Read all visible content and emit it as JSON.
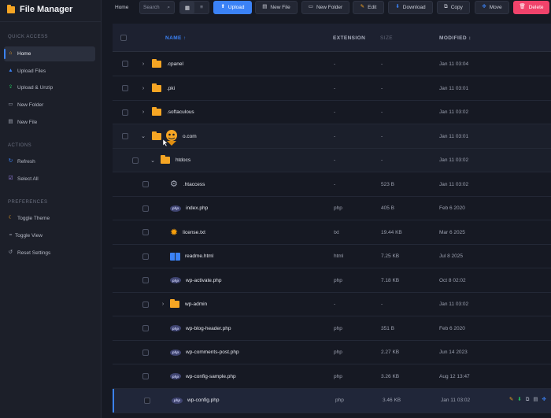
{
  "app": {
    "title": "File Manager"
  },
  "sidebar": {
    "quick_access_label": "QUICK ACCESS",
    "quick_access": [
      {
        "label": "Home",
        "icon": "home-icon",
        "active": true
      },
      {
        "label": "Upload Files",
        "icon": "upload-icon"
      },
      {
        "label": "Upload & Unzip",
        "icon": "upload-unzip-icon"
      },
      {
        "label": "New Folder",
        "icon": "new-folder-icon"
      },
      {
        "label": "New File",
        "icon": "new-file-icon"
      }
    ],
    "actions_label": "ACTIONS",
    "actions": [
      {
        "label": "Refresh",
        "icon": "refresh-icon"
      },
      {
        "label": "Select All",
        "icon": "checkbox-icon"
      }
    ],
    "preferences_label": "PREFERENCES",
    "preferences": [
      {
        "label": "Toggle Theme",
        "icon": "moon-icon"
      },
      {
        "label": "Toggle View",
        "icon": "view-icon"
      },
      {
        "label": "Reset Settings",
        "icon": "reset-icon"
      }
    ]
  },
  "toolbar": {
    "home": "Home",
    "search_placeholder": "Search",
    "upload": "Upload",
    "new_file": "New File",
    "new_folder": "New Folder",
    "edit": "Edit",
    "download": "Download",
    "copy": "Copy",
    "move": "Move",
    "delete": "Delete"
  },
  "colors": {
    "accent": "#3b82f6",
    "danger": "#f0436b",
    "folder": "#f5a524"
  },
  "table": {
    "headers": {
      "name": "NAME",
      "name_sort": "↑",
      "extension": "EXTENSION",
      "size": "SIZE",
      "modified": "MODIFIED",
      "modified_sort": "↕"
    },
    "rows": [
      {
        "name": ".cpanel",
        "ext": "-",
        "size": "-",
        "modified": "Jan 11 03:04",
        "icon": "folder-icon",
        "chevron": "›"
      },
      {
        "name": ".pki",
        "ext": "-",
        "size": "-",
        "modified": "Jan 11 03:01",
        "icon": "folder-icon",
        "chevron": "›"
      },
      {
        "name": ".softaculous",
        "ext": "-",
        "size": "-",
        "modified": "Jan 11 03:02",
        "icon": "folder-icon",
        "chevron": "›"
      },
      {
        "name": "o.com",
        "ext": "-",
        "size": "-",
        "modified": "Jan 11 03:01",
        "icon": "folder-icon",
        "chevron": "⌄"
      },
      {
        "name": "htdocs",
        "ext": "-",
        "size": "-",
        "modified": "Jan 11 03:02",
        "icon": "folder-icon",
        "chevron": "⌄"
      },
      {
        "name": ".htaccess",
        "ext": "-",
        "size": "523 B",
        "modified": "Jan 11 03:02",
        "icon": "gear-icon"
      },
      {
        "name": "index.php",
        "ext": "php",
        "size": "405 B",
        "modified": "Feb 6 2020",
        "icon": "php-icon"
      },
      {
        "name": "license.txt",
        "ext": "txt",
        "size": "19.44 KB",
        "modified": "Mar 6 2025",
        "icon": "sun-icon"
      },
      {
        "name": "readme.html",
        "ext": "html",
        "size": "7.25 KB",
        "modified": "Jul 8 2025",
        "icon": "book-icon"
      },
      {
        "name": "wp-activate.php",
        "ext": "php",
        "size": "7.18 KB",
        "modified": "Oct 8 02:02",
        "icon": "php-icon"
      },
      {
        "name": "wp-admin",
        "ext": "-",
        "size": "-",
        "modified": "Jan 11 03:02",
        "icon": "folder-icon",
        "chevron": "›"
      },
      {
        "name": "wp-blog-header.php",
        "ext": "php",
        "size": "351 B",
        "modified": "Feb 6 2020",
        "icon": "php-icon"
      },
      {
        "name": "wp-comments-post.php",
        "ext": "php",
        "size": "2.27 KB",
        "modified": "Jun 14 2023",
        "icon": "php-icon"
      },
      {
        "name": "wp-config-sample.php",
        "ext": "php",
        "size": "3.26 KB",
        "modified": "Aug 12 13:47",
        "icon": "php-icon"
      },
      {
        "name": "wp-config.php",
        "ext": "php",
        "size": "3.46 KB",
        "modified": "Jan 11 03:02",
        "icon": "php-icon"
      }
    ],
    "php_badge": "php"
  }
}
